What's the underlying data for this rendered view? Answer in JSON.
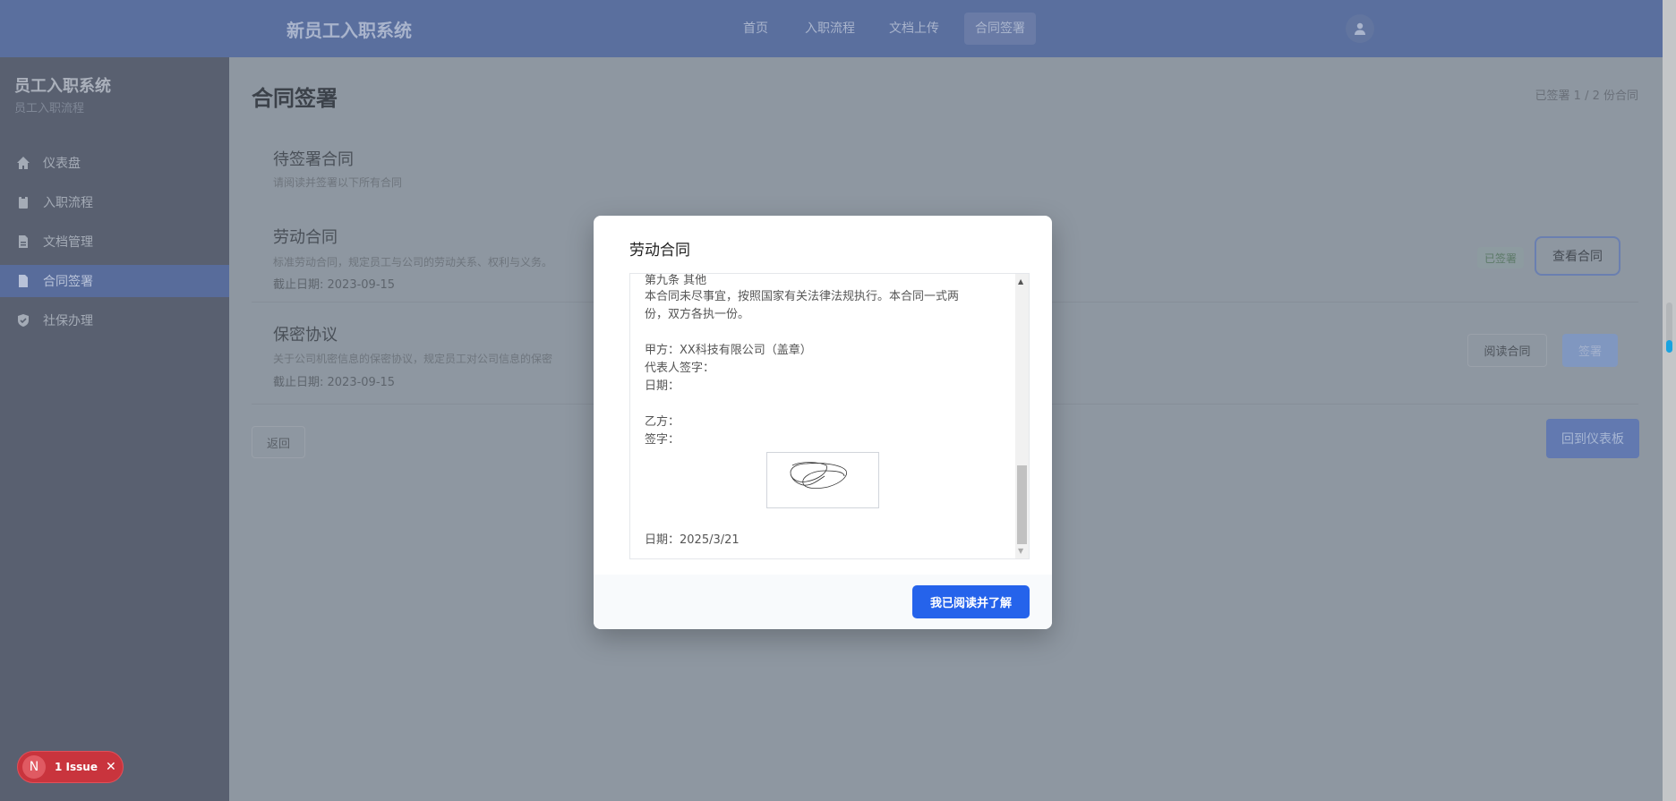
{
  "header": {
    "title": "新员工入职系统",
    "nav": [
      "首页",
      "入职流程",
      "文档上传",
      "合同签署"
    ],
    "active_nav": "合同签署"
  },
  "sidebar": {
    "title": "员工入职系统",
    "subtitle": "员工入职流程",
    "items": [
      {
        "label": "仪表盘",
        "icon": "home-icon"
      },
      {
        "label": "入职流程",
        "icon": "clipboard-icon"
      },
      {
        "label": "文档管理",
        "icon": "document-icon"
      },
      {
        "label": "合同签署",
        "icon": "file-icon",
        "active": true
      },
      {
        "label": "社保办理",
        "icon": "shield-icon"
      }
    ]
  },
  "main": {
    "title": "合同签署",
    "progress": "已签署 1 / 2 份合同",
    "section": {
      "title": "待签署合同",
      "subtitle": "请阅读并签署以下所有合同"
    },
    "contracts": [
      {
        "title": "劳动合同",
        "desc": "标准劳动合同，规定员工与公司的劳动关系、权利与义务。",
        "deadline": "截止日期: 2023-09-15",
        "status": "已签署",
        "action": "查看合同"
      },
      {
        "title": "保密协议",
        "desc": "关于公司机密信息的保密协议，规定员工对公司信息的保密",
        "deadline": "截止日期: 2023-09-15",
        "read": "阅读合同",
        "sign": "签署"
      }
    ],
    "back": "返回",
    "dashboard": "回到仪表板"
  },
  "modal": {
    "title": "劳动合同",
    "lines": [
      "第九条 其他",
      "本合同未尽事宜，按照国家有关法律法规执行。本合同一式两",
      "份，双方各执一份。",
      "甲方：XX科技有限公司（盖章）",
      "代表人签字：",
      "日期：",
      "乙方：",
      "签字：",
      "日期：2025/3/21"
    ],
    "confirm": "我已阅读并了解"
  },
  "issue_badge": {
    "letter": "N",
    "label": "1 Issue"
  },
  "colors": {
    "primary": "#2563eb",
    "issue": "#c9343d"
  }
}
